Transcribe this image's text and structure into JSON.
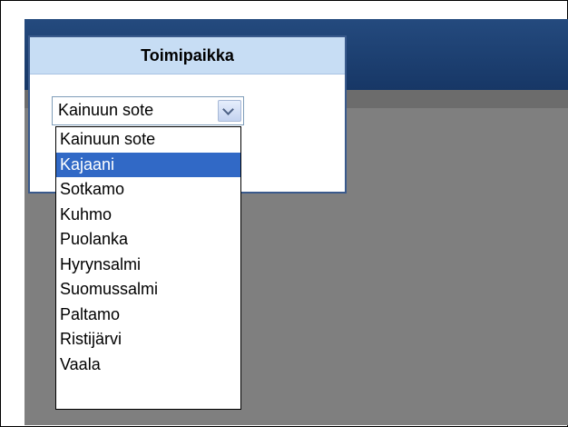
{
  "dialog": {
    "title": "Toimipaikka"
  },
  "select": {
    "value": "Kainuun sote"
  },
  "dropdown": {
    "highlighted_index": 1,
    "options": [
      "Kainuun sote",
      "Kajaani",
      "Sotkamo",
      "Kuhmo",
      "Puolanka",
      "Hyrynsalmi",
      "Suomussalmi",
      "Paltamo",
      "Ristijärvi",
      "Vaala"
    ]
  }
}
